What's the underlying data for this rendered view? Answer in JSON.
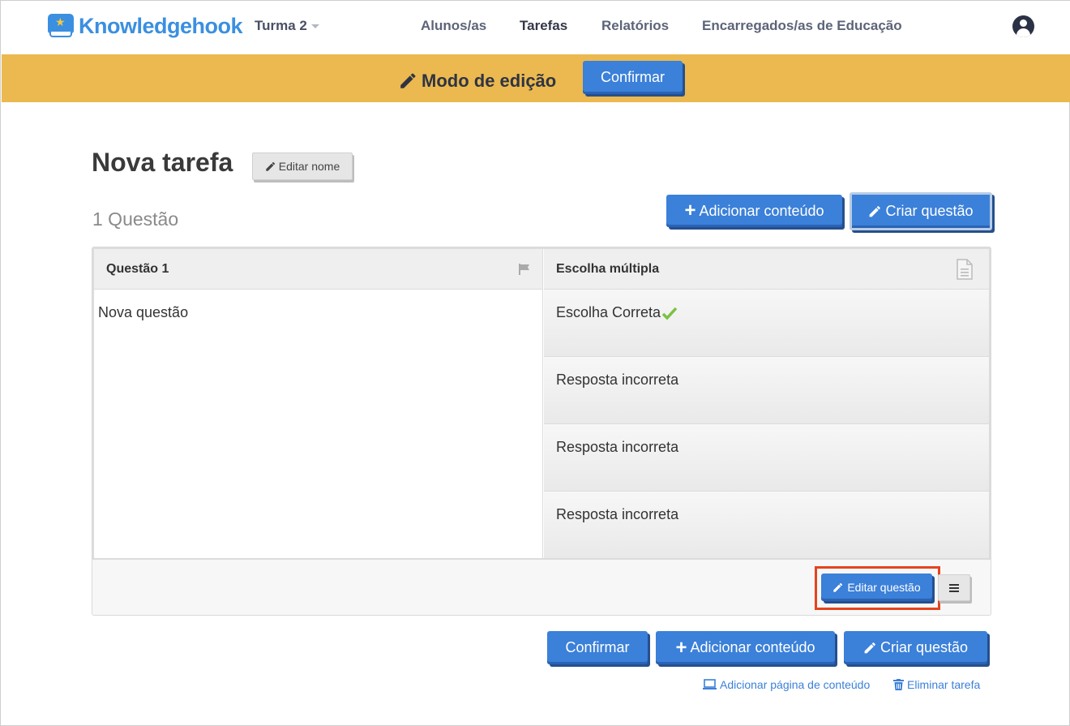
{
  "header": {
    "brand": "Knowledgehook",
    "class_selector": "Turma 2",
    "nav": [
      "Alunos/as",
      "Tarefas",
      "Relatórios",
      "Encarregados/as de Educação"
    ]
  },
  "editbar": {
    "mode_label": "Modo de edição",
    "confirm_label": "Confirmar"
  },
  "task": {
    "title": "Nova tarefa",
    "edit_name_label": "Editar nome",
    "question_count": "1 Questão",
    "add_content_label": "Adicionar conteúdo",
    "create_question_label": "Criar questão"
  },
  "question": {
    "header": "Questão 1",
    "type": "Escolha múltipla",
    "text": "Nova questão",
    "answers": [
      "Escolha Correta",
      "Resposta incorreta",
      "Resposta incorreta",
      "Resposta incorreta"
    ],
    "edit_label": "Editar questão"
  },
  "footer": {
    "confirm_label": "Confirmar",
    "add_content_label": "Adicionar conteúdo",
    "create_question_label": "Criar questão",
    "add_page_link": "Adicionar página de conteúdo",
    "delete_link": "Eliminar tarefa"
  },
  "colors": {
    "accent_blue": "#3b80d9",
    "edit_bar": "#ebb94f",
    "correct_check": "#7bc142",
    "highlight": "#e5431f"
  }
}
